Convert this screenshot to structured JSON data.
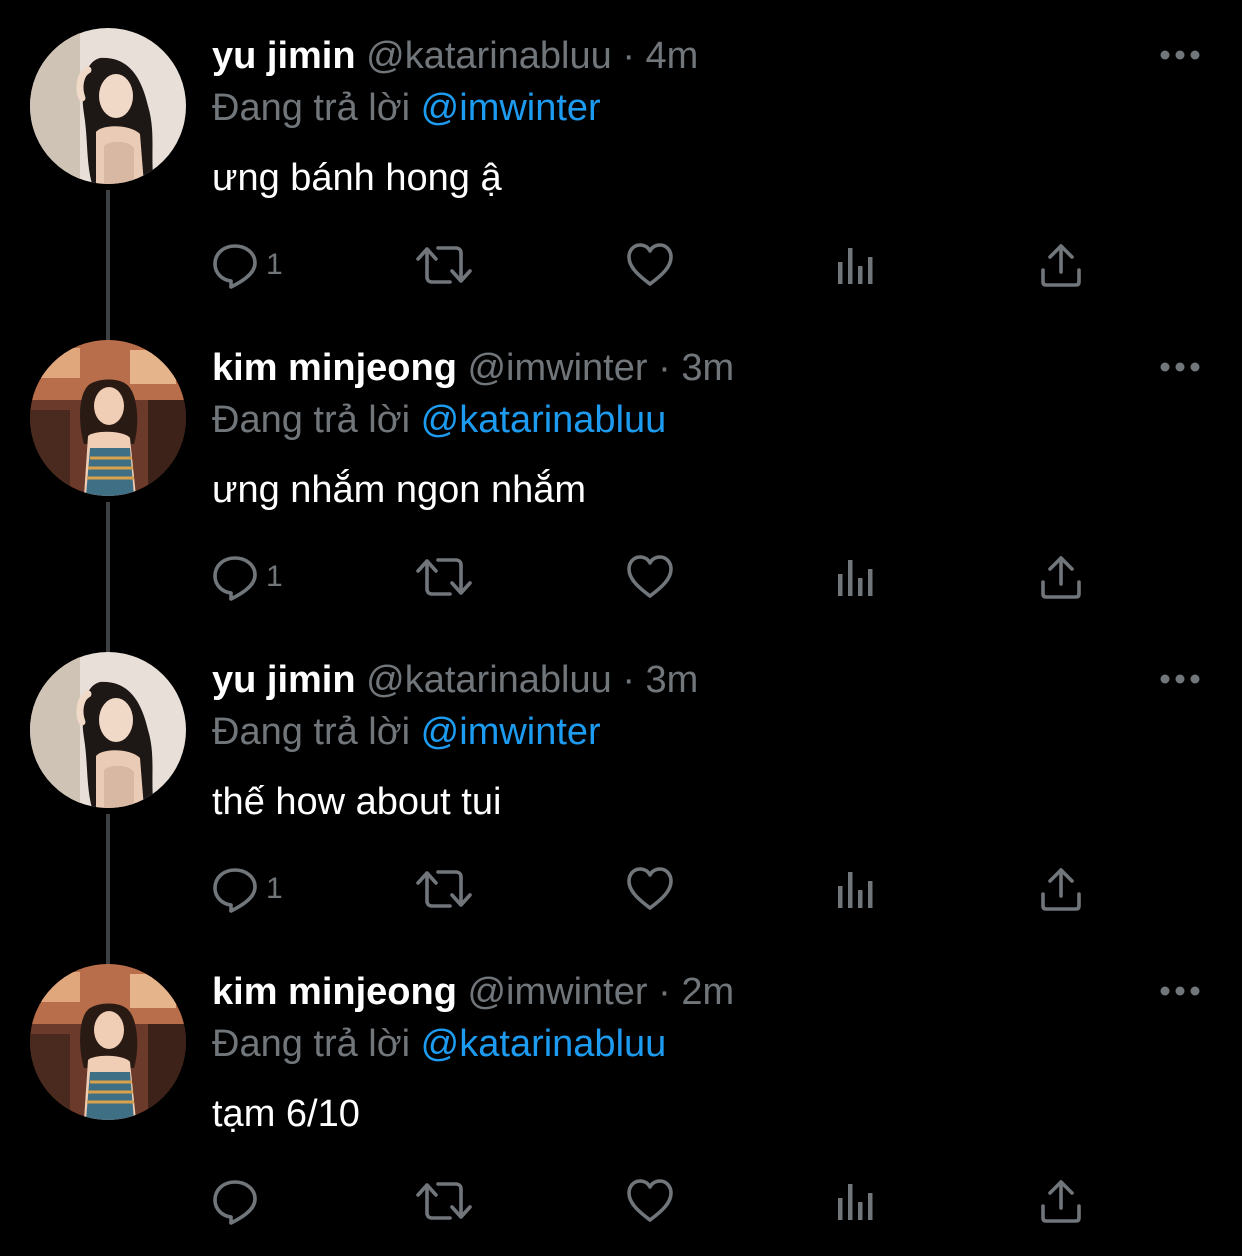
{
  "colors": {
    "background": "#000000",
    "name": "#ffffff",
    "secondary_text": "#71767b",
    "mention": "#1d9bf0",
    "thread_line": "#3e4144"
  },
  "icons": {
    "more": "more-horizontal-icon",
    "reply": "speech-bubble-icon",
    "retweet": "retweet-arrows-icon",
    "like": "heart-icon",
    "views": "bar-chart-icon",
    "share": "share-upload-icon"
  },
  "tweets": [
    {
      "name": "yu jimin",
      "handle": "@katarinabluu",
      "separator": "·",
      "time": "4m",
      "replying_prefix": "Đang trả lời",
      "replying_to": "@imwinter",
      "text": "ưng bánh hong ậ",
      "reply_count": "1"
    },
    {
      "name": "kim minjeong",
      "handle": "@imwinter",
      "separator": "·",
      "time": "3m",
      "replying_prefix": "Đang trả lời",
      "replying_to": "@katarinabluu",
      "text": "ưng nhắm ngon nhắm",
      "reply_count": "1"
    },
    {
      "name": "yu jimin",
      "handle": "@katarinabluu",
      "separator": "·",
      "time": "3m",
      "replying_prefix": "Đang trả lời",
      "replying_to": "@imwinter",
      "text": "thế how about tui",
      "reply_count": "1"
    },
    {
      "name": "kim minjeong",
      "handle": "@imwinter",
      "separator": "·",
      "time": "2m",
      "replying_prefix": "Đang trả lời",
      "replying_to": "@katarinabluu",
      "text": "tạm 6/10",
      "reply_count": ""
    }
  ]
}
